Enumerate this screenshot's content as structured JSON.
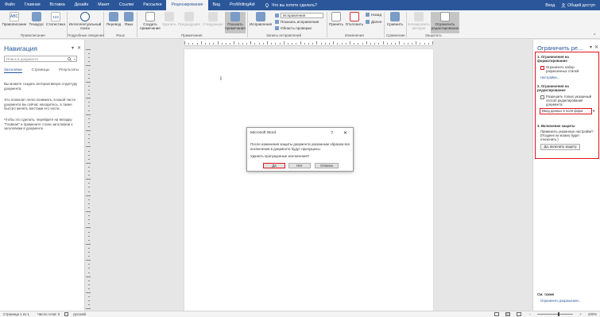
{
  "tabs": [
    "Файл",
    "Главная",
    "Вставка",
    "Дизайн",
    "Макет",
    "Ссылки",
    "Рассылки",
    "Рецензирование",
    "Вид",
    "ProWritingAid"
  ],
  "active_tab": "Рецензирование",
  "tell_me": "Что вы хотите сделать?",
  "sign_in": "Вход",
  "share": "Общий доступ",
  "ribbon": {
    "spelling": "Правописание",
    "thesaurus": "Тезаурус",
    "stats": "Статистика",
    "smart_lookup": "Интеллектуальный поиск",
    "translate": "Перевод",
    "language": "Язык",
    "new_comment": "Создать примечание",
    "delete": "Удалить",
    "previous": "Предыдущее",
    "next": "Следующее",
    "show_comments": "Показать примечания",
    "track_changes": "Исправления",
    "markup_select": "Исправления",
    "show_markup": "Показать исправления",
    "reviewing_pane": "Область проверки",
    "accept": "Принять",
    "reject": "Отклонить",
    "prev_change": "Назад",
    "next_change": "Далее",
    "compare": "Сравнить",
    "block_authors": "Блокировать авторов",
    "restrict_editing": "Ограничить редактирование",
    "groups": {
      "proofing": "Правописание",
      "insights": "Подробные сведения",
      "language": "Язык",
      "comments": "Примечания",
      "tracking": "Запись исправлений",
      "changes": "Изменения",
      "compare": "Сравнение",
      "protect": "Защитить"
    }
  },
  "nav": {
    "title": "Навигация",
    "search_placeholder": "Поиск в документе",
    "tabs": [
      "Заголовки",
      "Страницы",
      "Результаты"
    ],
    "p1": "Вы можете создать интерактивную структуру документа.",
    "p2": "Это позволит легко понимать, в какой части документа вы сейчас находитесь, а также быстро менять местами его части.",
    "p3": "Чтобы это сделать, перейдите на вкладку \"Главная\" и примените стили заголовков к заголовкам в документе."
  },
  "dialog": {
    "title": "Microsoft Word",
    "help": "?",
    "message": "После изменения защиты документа указанным образом все исключения в документе будут пропущены.",
    "question": "Удалить пропущенные исключения?",
    "yes": "Да",
    "no": "Нет",
    "cancel": "Отмена"
  },
  "restrict_pane": {
    "title": "Ограничить ре...",
    "s1_title": "1. Ограничения на форматирование",
    "s1_check": "Ограничить набор разрешенных стилей",
    "s1_link": "Настройки...",
    "s2_title": "2. Ограничения на редактирование",
    "s2_check": "Разрешить только указанный способ редактирования документа:",
    "s2_select": "Ввод данных в поля форм",
    "s3_title": "3. Включение защиты",
    "s3_text": "Применить указанные настройки? (Позднее их можно будет отключить.)",
    "s3_button": "Да, включить защиту",
    "see_also": "См. также",
    "see_also_link": "Ограничить разрешения..."
  },
  "status": {
    "page": "Страница 1 из 1",
    "words": "Число слов: 0",
    "language": "русский",
    "zoom": "100%"
  },
  "colors": {
    "word_blue": "#2b579a",
    "highlight_red": "#e1141d"
  }
}
